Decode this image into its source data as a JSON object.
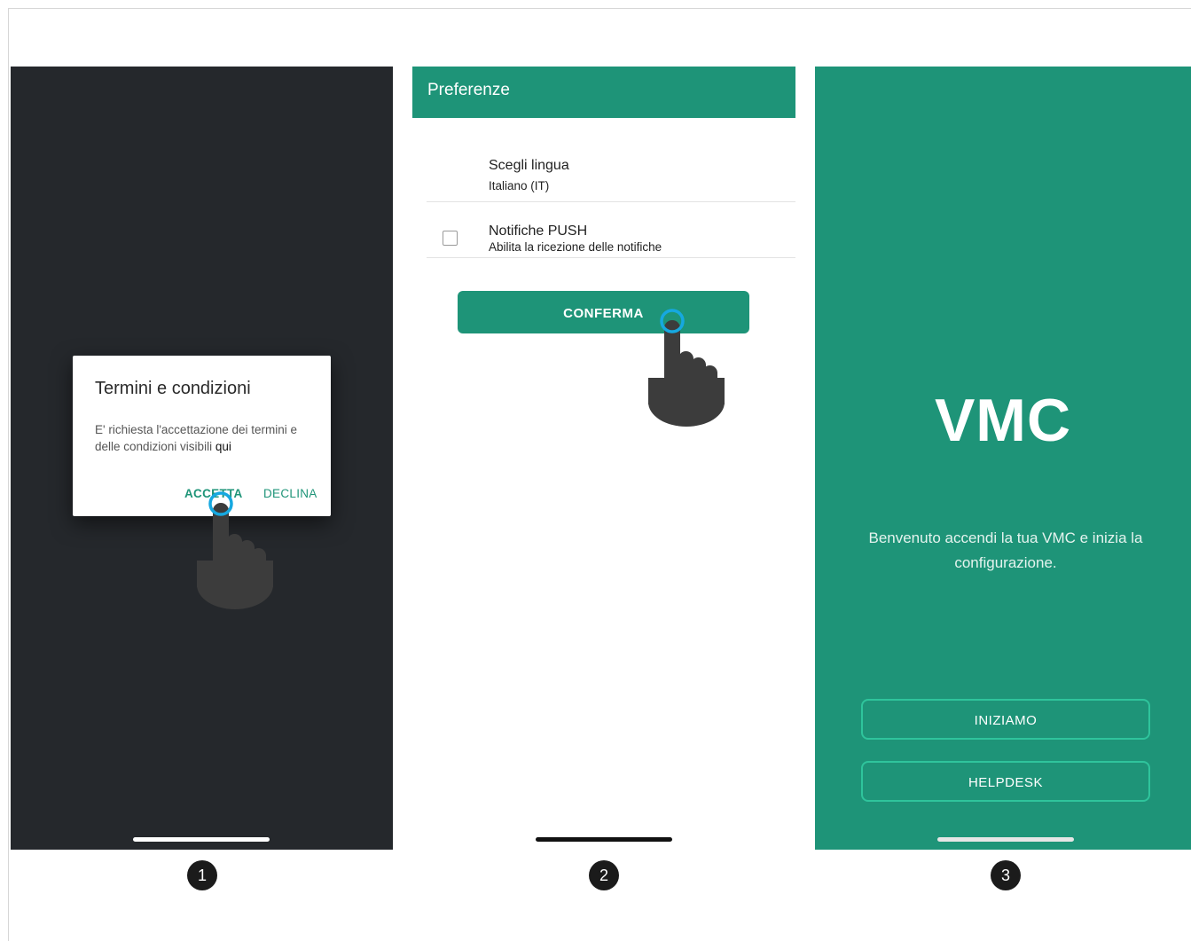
{
  "screens": [
    {
      "step": "1",
      "dialog": {
        "title": "Termini e condizioni",
        "body": "E' richiesta l'accettazione dei termini e delle condizioni visibili",
        "link": "qui",
        "accept": "ACCETTA",
        "decline": "DECLINA"
      }
    },
    {
      "step": "2",
      "appbar_title": "Preferenze",
      "language": {
        "title": "Scegli lingua",
        "value": "Italiano (IT)"
      },
      "push": {
        "title": "Notifiche PUSH",
        "subtitle": "Abilita la ricezione delle notifiche",
        "checked": false
      },
      "confirm": "CONFERMA"
    },
    {
      "step": "3",
      "logo": "VMC",
      "welcome": "Benvenuto accendi la tua VMC e inizia la configurazione.",
      "start": "INIZIAMO",
      "helpdesk": "HELPDESK"
    }
  ],
  "colors": {
    "brand": "#1e9478",
    "dark_bg": "#25282c",
    "button_outline": "#2fc49c",
    "tap_ring": "#16a8e0",
    "hand": "#3c3c3c"
  },
  "icons": [
    "pointer-hand-icon",
    "tap-ring-icon",
    "checkbox-icon"
  ]
}
